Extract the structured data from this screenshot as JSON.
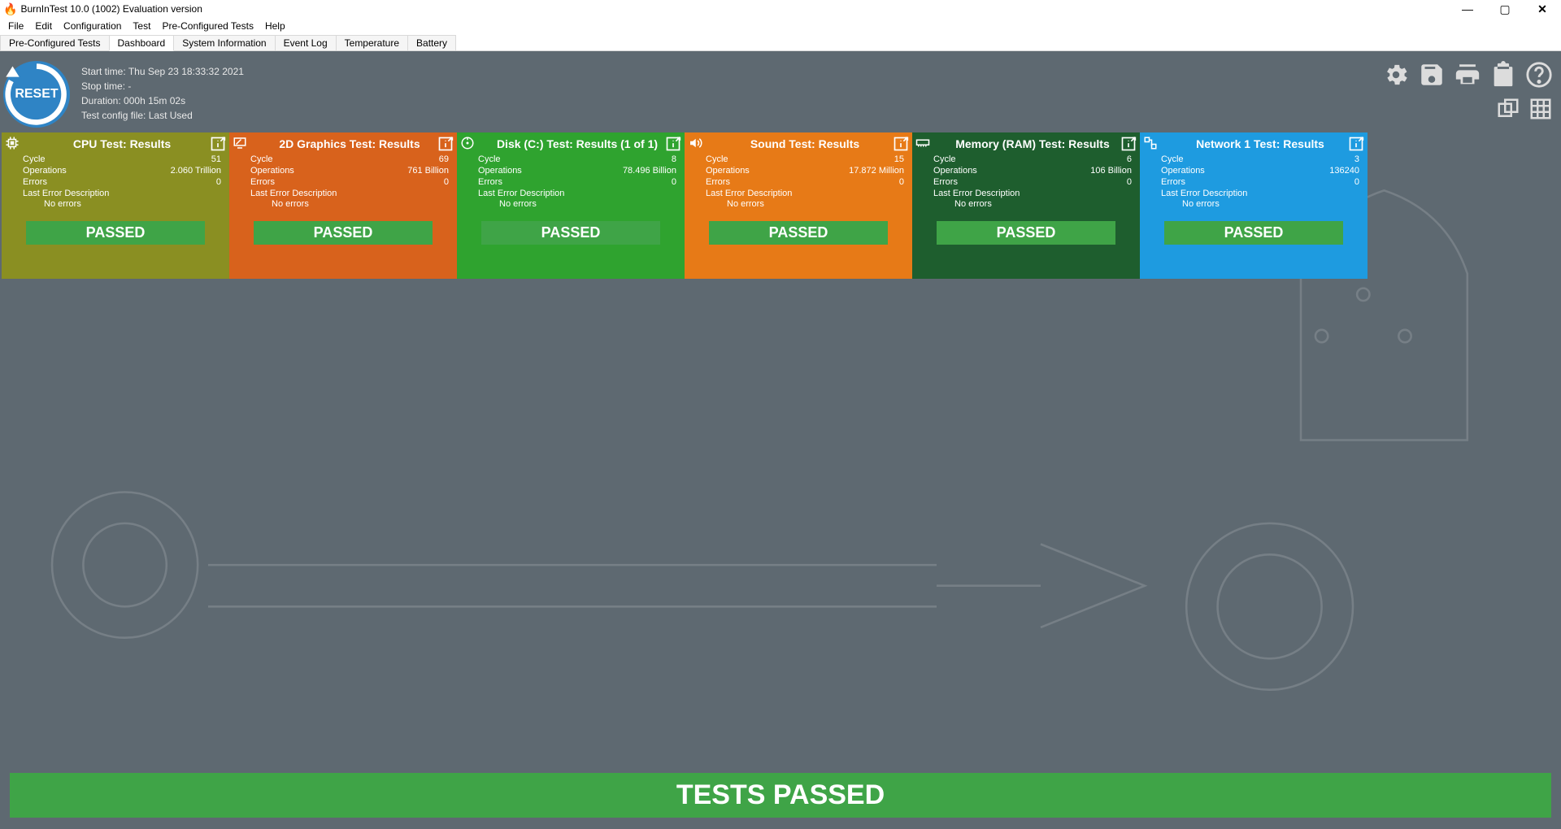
{
  "window": {
    "title": "BurnInTest 10.0 (1002) Evaluation version"
  },
  "menubar": [
    "File",
    "Edit",
    "Configuration",
    "Test",
    "Pre-Configured Tests",
    "Help"
  ],
  "tabs": [
    "Pre-Configured Tests",
    "Dashboard",
    "System Information",
    "Event Log",
    "Temperature",
    "Battery"
  ],
  "active_tab": 1,
  "runinfo": {
    "start_label": "Start time:",
    "start_value": "Thu Sep 23 18:33:32 2021",
    "stop_label": "Stop time:",
    "stop_value": "-",
    "duration_label": "Duration:",
    "duration_value": "000h 15m 02s",
    "config_label": "Test config file:",
    "config_value": "Last Used"
  },
  "reset_label": "RESET",
  "labels": {
    "cycle": "Cycle",
    "operations": "Operations",
    "errors": "Errors",
    "last_error": "Last Error Description",
    "no_errors": "No errors",
    "passed": "PASSED"
  },
  "tiles": [
    {
      "id": "cpu",
      "icon": "cpu",
      "color": "bg-olive",
      "title": "CPU Test: Results",
      "cycle": "51",
      "operations": "2.060 Trillion",
      "errors": "0"
    },
    {
      "id": "2d",
      "icon": "monitor",
      "color": "bg-orange1",
      "title": "2D Graphics Test: Results",
      "cycle": "69",
      "operations": "761 Billion",
      "errors": "0"
    },
    {
      "id": "disk",
      "icon": "disk",
      "color": "bg-green",
      "title": "Disk (C:) Test: Results (1 of 1)",
      "cycle": "8",
      "operations": "78.496 Billion",
      "errors": "0"
    },
    {
      "id": "sound",
      "icon": "speaker",
      "color": "bg-orange2",
      "title": "Sound Test: Results",
      "cycle": "15",
      "operations": "17.872 Million",
      "errors": "0"
    },
    {
      "id": "ram",
      "icon": "ram",
      "color": "bg-dgreen",
      "title": "Memory (RAM) Test: Results",
      "cycle": "6",
      "operations": "106 Billion",
      "errors": "0"
    },
    {
      "id": "net",
      "icon": "network",
      "color": "bg-blue",
      "title": "Network 1 Test: Results",
      "cycle": "3",
      "operations": "136240",
      "errors": "0"
    }
  ],
  "banner": "TESTS PASSED"
}
